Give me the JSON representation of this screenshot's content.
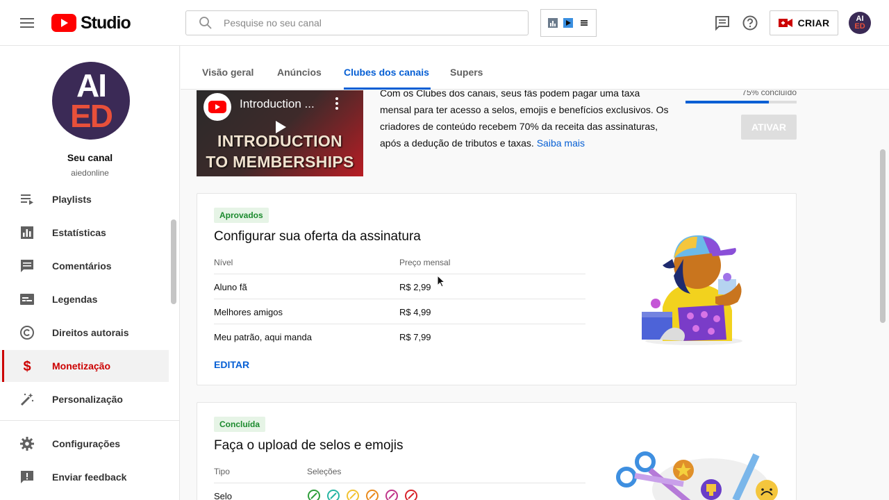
{
  "header": {
    "logo_text": "Studio",
    "search_placeholder": "Pesquise no seu canal",
    "create_label": "CRIAR",
    "avatar_line1": "AI",
    "avatar_line2": "ED",
    "icons": [
      "menu-icon",
      "youtube-logo-icon",
      "search-icon",
      "feedback-icon",
      "help-icon",
      "video-camera-icon"
    ],
    "accent_color": "#cc0000"
  },
  "sidebar": {
    "avatar_line1": "AI",
    "avatar_line2": "ED",
    "channel_name": "Seu canal",
    "channel_handle": "aiedonline",
    "items": [
      {
        "label": "Playlists",
        "icon": "playlist-icon"
      },
      {
        "label": "Estatísticas",
        "icon": "analytics-icon"
      },
      {
        "label": "Comentários",
        "icon": "comments-icon"
      },
      {
        "label": "Legendas",
        "icon": "subtitles-icon"
      },
      {
        "label": "Direitos autorais",
        "icon": "copyright-icon"
      },
      {
        "label": "Monetização",
        "icon": "dollar-icon",
        "active": true
      },
      {
        "label": "Personalização",
        "icon": "magic-wand-icon"
      },
      {
        "label": "Configurações",
        "icon": "gear-icon"
      },
      {
        "label": "Enviar feedback",
        "icon": "feedback-icon"
      }
    ]
  },
  "tabs": [
    {
      "label": "Visão geral"
    },
    {
      "label": "Anúncios"
    },
    {
      "label": "Clubes dos canais",
      "active": true
    },
    {
      "label": "Supers"
    }
  ],
  "intro": {
    "video_title": "Introduction ...",
    "video_big_line1": "INTRODUCTION",
    "video_big_line2": "TO MEMBERSHIPS",
    "text": "Com os Clubes dos canais, seus fãs podem pagar uma taxa mensal para ter acesso a selos, emojis e benefícios exclusivos. Os criadores de conteúdo recebem 70% da receita das assinaturas, após a dedução de tributos e taxas.",
    "link": "Saiba mais",
    "progress_label": "75% concluído",
    "progress_value": 0.75,
    "activate_label": "ATIVAR"
  },
  "offer_card": {
    "badge": "Aprovados",
    "title": "Configurar sua oferta da assinatura",
    "col_level": "Nível",
    "col_price": "Preço mensal",
    "rows": [
      {
        "level": "Aluno fã",
        "price": "R$ 2,99"
      },
      {
        "level": "Melhores amigos",
        "price": "R$ 4,99"
      },
      {
        "level": "Meu patrão, aqui manda",
        "price": "R$ 7,99"
      }
    ],
    "edit_label": "EDITAR"
  },
  "upload_card": {
    "badge": "Concluída",
    "title": "Faça o upload de selos e emojis",
    "col_type": "Tipo",
    "col_selections": "Seleções",
    "row_type": "Selo",
    "badge_colors": [
      "#2e9e3a",
      "#26b5a3",
      "#f2c230",
      "#e98a1c",
      "#c0348a",
      "#d8232a"
    ]
  }
}
